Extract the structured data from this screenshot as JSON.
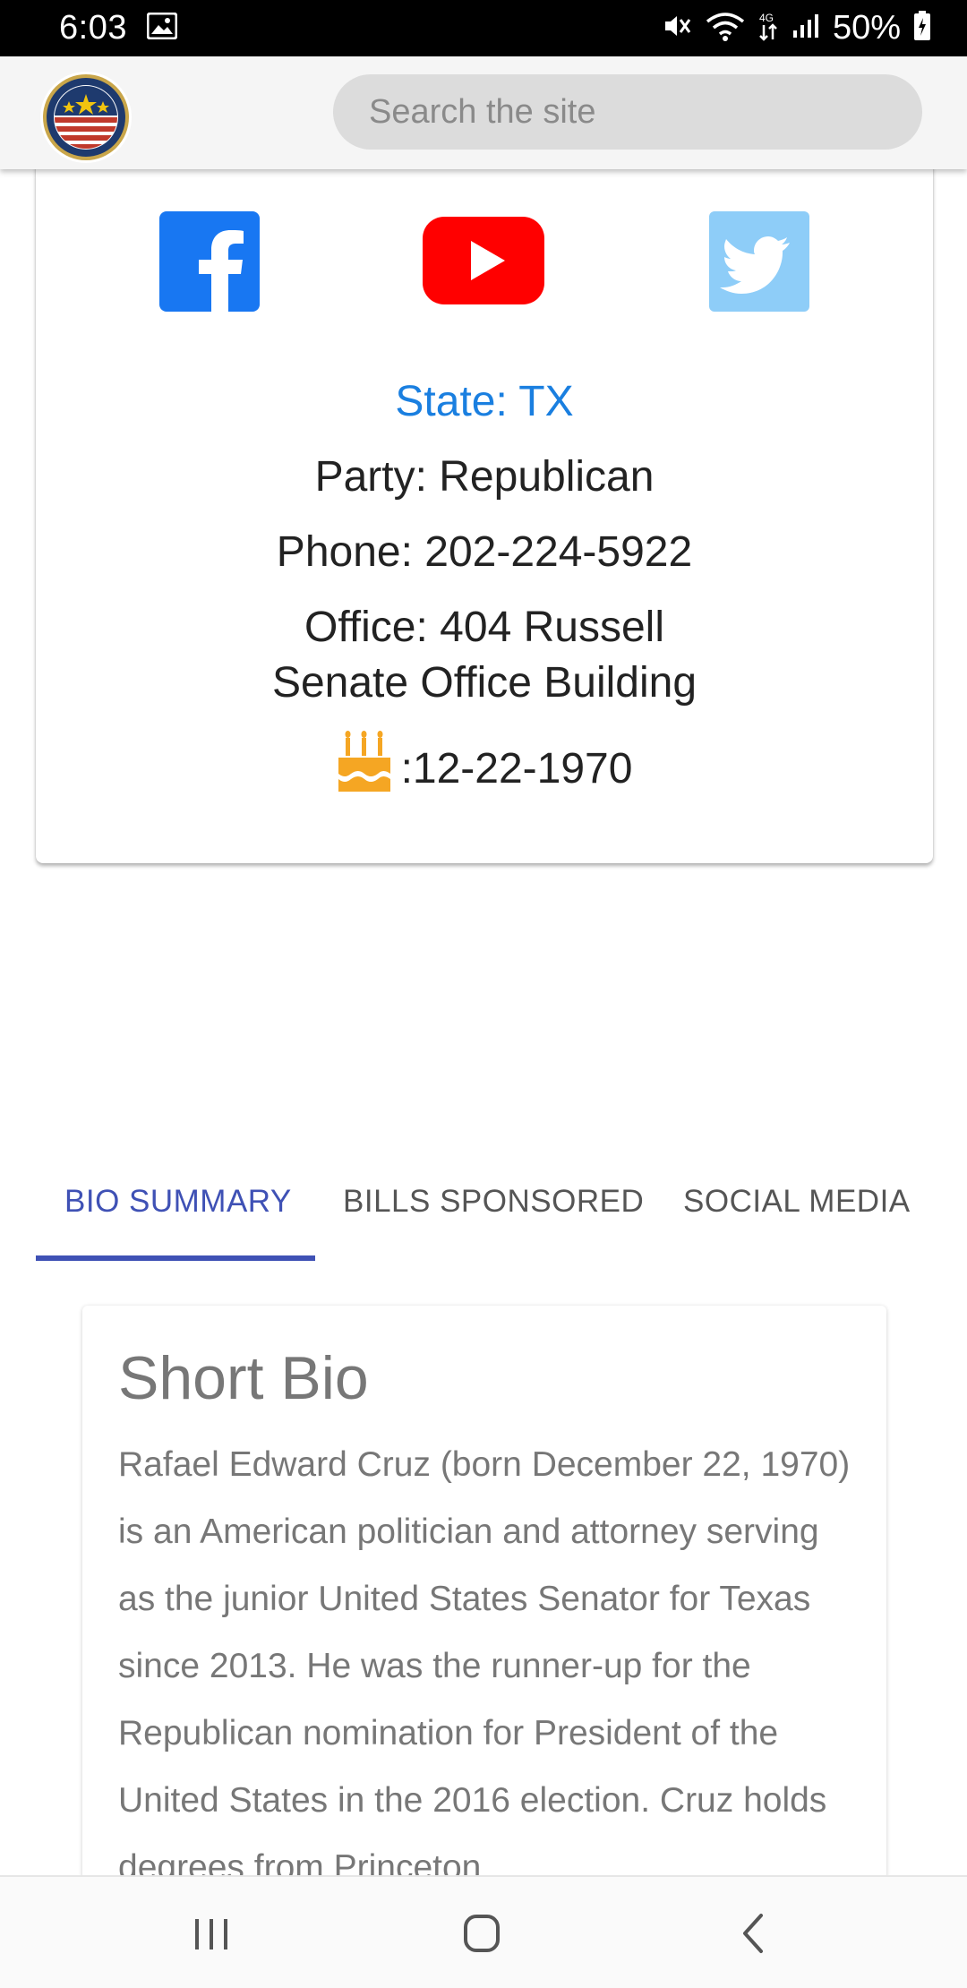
{
  "status_bar": {
    "time": "6:03",
    "battery_percent": "50%",
    "icons": [
      "gallery-icon",
      "mute-icon",
      "wifi-icon",
      "4g-icon",
      "signal-icon",
      "battery-charging-icon"
    ]
  },
  "header": {
    "logo_icon": "seal-stars-stripes-icon",
    "search_placeholder": "Search the site"
  },
  "profile": {
    "social_links": [
      "facebook-icon",
      "youtube-icon",
      "twitter-icon"
    ],
    "state": "State: TX",
    "party": "Party: Republican",
    "phone": "Phone: 202-224-5922",
    "office": "Office: 404 Russell Senate Office Building",
    "birthday_icon": "birthday-cake-icon",
    "birthday": ":12-22-1970"
  },
  "tabs": [
    {
      "label": "BIO SUMMARY",
      "active": true
    },
    {
      "label": "BILLS SPONSORED",
      "active": false
    },
    {
      "label": "SOCIAL MEDIA",
      "active": false
    }
  ],
  "bio": {
    "title": "Short Bio",
    "text": "Rafael Edward Cruz (born December 22, 1970) is an American politician and attorney serving as the junior United States Senator for Texas since 2013. He was the runner-up for the Republican nomination for President of the United States in the 2016 election. Cruz holds degrees from Princeton"
  },
  "nav_bar": {
    "buttons": [
      "recent-apps-icon",
      "home-icon",
      "back-icon"
    ]
  },
  "colors": {
    "accent": "#3f51b5",
    "state_blue": "#1a7fe0",
    "facebook": "#1877f2",
    "youtube": "#ff0000",
    "twitter": "#8ecdf8",
    "cake": "#f5a623"
  }
}
